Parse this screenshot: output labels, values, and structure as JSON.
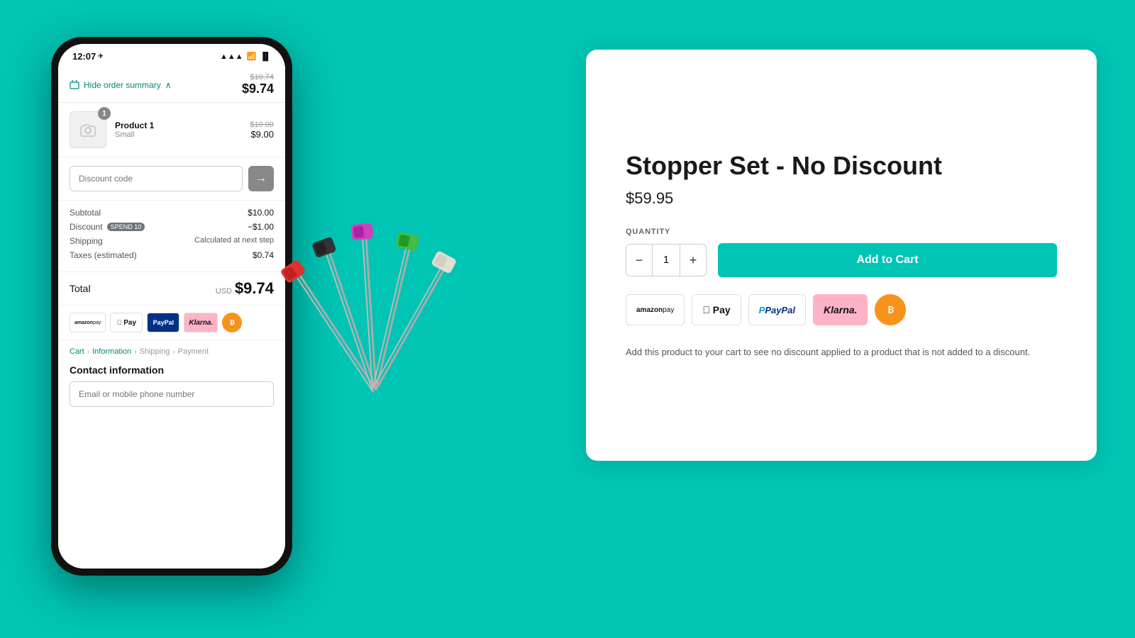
{
  "background_color": "#00C4B4",
  "phone": {
    "status_bar": {
      "time": "12:07",
      "location_icon": "▶",
      "signal": "▲▲▲",
      "wifi": "wifi",
      "battery": "▐▌"
    },
    "order_summary": {
      "toggle_label": "Hide order summary",
      "chevron": "∧",
      "total_original": "$10.74",
      "total_price": "$9.74"
    },
    "product": {
      "name": "Product 1",
      "variant": "Small",
      "badge": "1",
      "price_original": "$10.00",
      "price": "$9.00"
    },
    "discount": {
      "placeholder": "Discount code",
      "button_icon": "→"
    },
    "order_rows": [
      {
        "label": "Subtotal",
        "value": "$10.00"
      },
      {
        "label": "Discount",
        "badge": "SPEND 10",
        "value": "−$1.00"
      },
      {
        "label": "Shipping",
        "value": "Calculated at next step"
      },
      {
        "label": "Taxes (estimated)",
        "value": "$0.74"
      }
    ],
    "total": {
      "label": "Total",
      "currency": "USD",
      "value": "$9.74"
    },
    "payment_logos": [
      {
        "label": "amazon pay",
        "type": "amazon"
      },
      {
        "label": "Apple Pay",
        "type": "apple"
      },
      {
        "label": "PayPal",
        "type": "paypal"
      },
      {
        "label": "Klarna.",
        "type": "klarna"
      },
      {
        "label": "₿",
        "type": "btc"
      }
    ],
    "breadcrumbs": [
      {
        "label": "Cart",
        "active": true
      },
      {
        "label": "Information",
        "active": true
      },
      {
        "label": "Shipping",
        "active": false
      },
      {
        "label": "Payment",
        "active": false
      }
    ],
    "contact": {
      "title": "Contact information",
      "email_placeholder": "Email or mobile phone number"
    }
  },
  "product_card": {
    "title": "Stopper Set - No Discount",
    "price": "$59.95",
    "quantity_label": "QUANTITY",
    "quantity_value": "1",
    "add_to_cart_label": "Add to Cart",
    "payment_icons": [
      {
        "label": "amazon pay",
        "type": "amazon"
      },
      {
        "label": "Apple Pay",
        "type": "apple"
      },
      {
        "label": "P PayPal",
        "type": "paypal"
      },
      {
        "label": "Klarna.",
        "type": "klarna"
      },
      {
        "label": "₿",
        "type": "btc"
      }
    ],
    "description": "Add this product to your cart to see no discount applied to a product that is not added to a discount.",
    "qty_decrease": "−",
    "qty_increase": "+"
  }
}
